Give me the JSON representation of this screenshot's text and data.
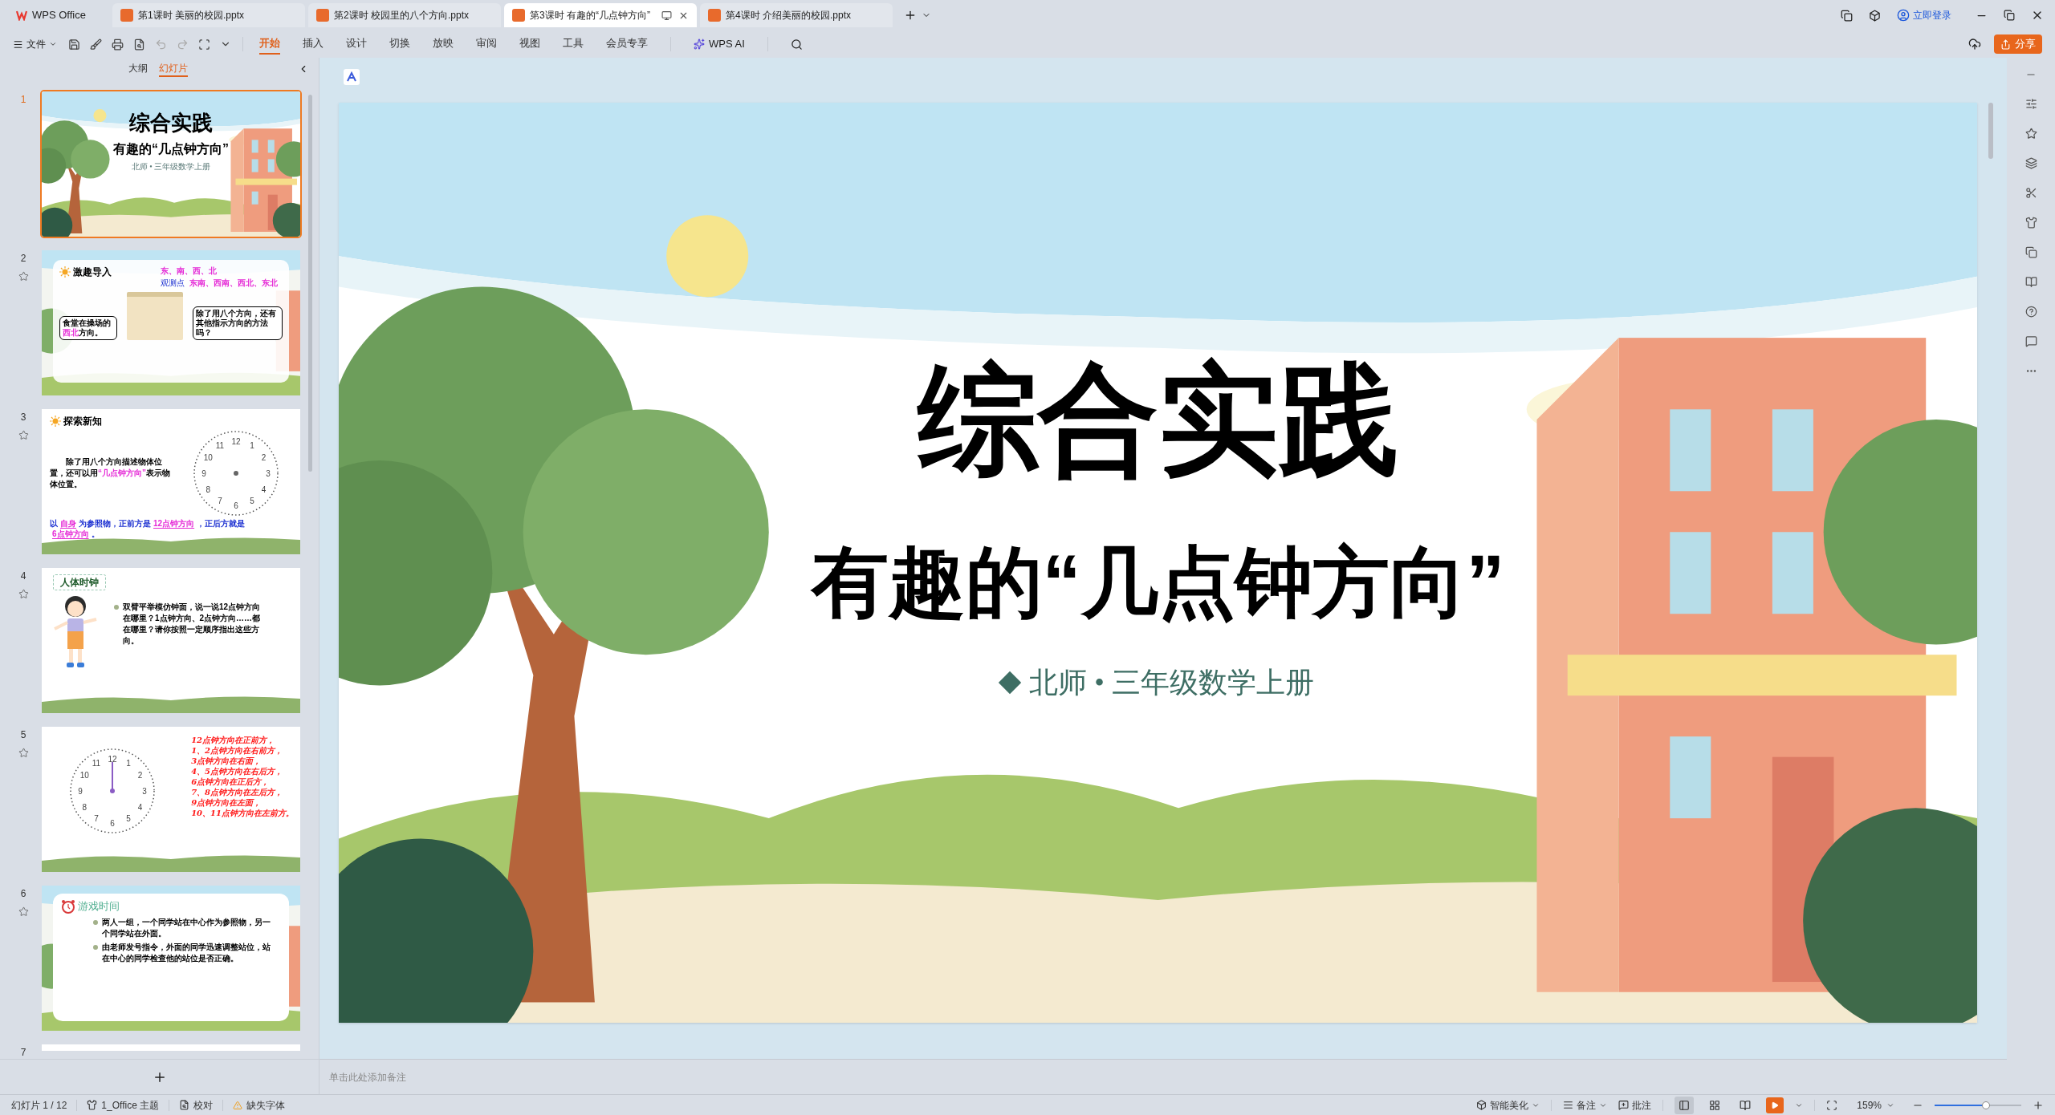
{
  "app_name": "WPS Office",
  "doc_tabs": [
    {
      "title": "第1课时 美丽的校园.pptx",
      "selected": false
    },
    {
      "title": "第2课时 校园里的八个方向.pptx",
      "selected": false
    },
    {
      "title": "第3课时 有趣的“几点钟方向”",
      "selected": true
    },
    {
      "title": "第4课时 介绍美丽的校园.pptx",
      "selected": false
    }
  ],
  "account": {
    "login": "立即登录",
    "share": "分享"
  },
  "ribbon": {
    "file_menu": "文件",
    "tabs": [
      {
        "label": "开始",
        "selected": true
      },
      {
        "label": "插入",
        "selected": false
      },
      {
        "label": "设计",
        "selected": false
      },
      {
        "label": "切换",
        "selected": false
      },
      {
        "label": "放映",
        "selected": false
      },
      {
        "label": "审阅",
        "selected": false
      },
      {
        "label": "视图",
        "selected": false
      },
      {
        "label": "工具",
        "selected": false
      },
      {
        "label": "会员专享",
        "selected": false
      }
    ],
    "ai": "WPS AI"
  },
  "panel": {
    "tabs": [
      {
        "label": "大纲",
        "selected": false
      },
      {
        "label": "幻灯片",
        "selected": true
      }
    ]
  },
  "slides": [
    {
      "number": "1",
      "selected": true,
      "kind": "cover",
      "title": "综合实践",
      "subtitle": "有趣的“几点钟方向”",
      "caption": "北师 • 三年级数学上册"
    },
    {
      "number": "2",
      "selected": false,
      "kind": "intro",
      "heading": "激趣导入",
      "line_1": "东、南、西、北",
      "line_2": "东南、西南、西北、东北",
      "pointer_label": "观测点",
      "bubble_left": [
        {
          "text": "食堂在操场的",
          "highlight": false
        },
        {
          "text": "西北",
          "highlight": true
        },
        {
          "text": "方向。",
          "highlight": false
        }
      ],
      "bubble_right": "除了用八个方向，还有其他指示方向的方法吗？"
    },
    {
      "number": "3",
      "selected": false,
      "kind": "explore",
      "heading": "探索新知",
      "paragraph": [
        {
          "text": "除了用八个方向描述物体位置，还可以用",
          "highlight": false
        },
        {
          "text": "“几点钟方向”",
          "highlight": true
        },
        {
          "text": "表示物体位置。",
          "highlight": false
        }
      ],
      "fill_in": [
        {
          "text": "以",
          "blank": false
        },
        {
          "text": "自身",
          "blank": true
        },
        {
          "text": "为参照物，正前方是",
          "blank": false
        },
        {
          "text": "12点钟方向",
          "blank": true
        },
        {
          "text": "，正后方就是",
          "blank": false
        },
        {
          "text": "6点钟方向",
          "blank": true
        },
        {
          "text": "。",
          "blank": false
        }
      ],
      "clock_numbers": [
        "12",
        "1",
        "2",
        "3",
        "4",
        "5",
        "6",
        "7",
        "8",
        "9",
        "10",
        "11"
      ]
    },
    {
      "number": "4",
      "selected": false,
      "kind": "body-clock",
      "heading": "人体时钟",
      "bullets": [
        "双臂平举模仿钟面，说一说12点钟方向在哪里？1点钟方向、2点钟方向……都在哪里？请你按照一定顺序指出这些方向。"
      ]
    },
    {
      "number": "5",
      "selected": false,
      "kind": "clock-list",
      "clock_numbers": [
        "12",
        "1",
        "2",
        "3",
        "4",
        "5",
        "6",
        "7",
        "8",
        "9",
        "10",
        "11"
      ],
      "lines": [
        "12点钟方向在正前方，",
        "1、2点钟方向在右前方，",
        "3点钟方向在右面，",
        "4、5点钟方向在右后方，",
        "6点钟方向在正后方，",
        "7、8点钟方向在左后方，",
        "9点钟方向在左面，",
        "10、11点钟方向在左前方。"
      ]
    },
    {
      "number": "6",
      "selected": false,
      "kind": "game",
      "heading": "游戏时间",
      "bullets": [
        "两人一组，一个同学站在中心作为参照物，另一个同学站在外面。",
        "由老师发号指令，外面的同学迅速调整站位，站在中心的同学检查他的站位是否正确。"
      ]
    },
    {
      "number": "7",
      "selected": false,
      "kind": "partial"
    }
  ],
  "editor": {
    "title": "综合实践",
    "subtitle": "有趣的“几点钟方向”",
    "caption": "北师 • 三年级数学上册"
  },
  "notes": {
    "placeholder": "单击此处添加备注"
  },
  "status_bar": {
    "slide_counter": "幻灯片 1 / 12",
    "theme": "1_Office 主题",
    "proofing": "校对",
    "missing_fonts": "缺失字体",
    "beautify": "智能美化",
    "notes": "备注",
    "comments": "批注",
    "views": [
      {
        "kind": "normal",
        "selected": true
      },
      {
        "kind": "sorter",
        "selected": false
      },
      {
        "kind": "reading",
        "selected": false
      }
    ],
    "zoom": {
      "reading": "159%",
      "level": 0.59
    }
  }
}
